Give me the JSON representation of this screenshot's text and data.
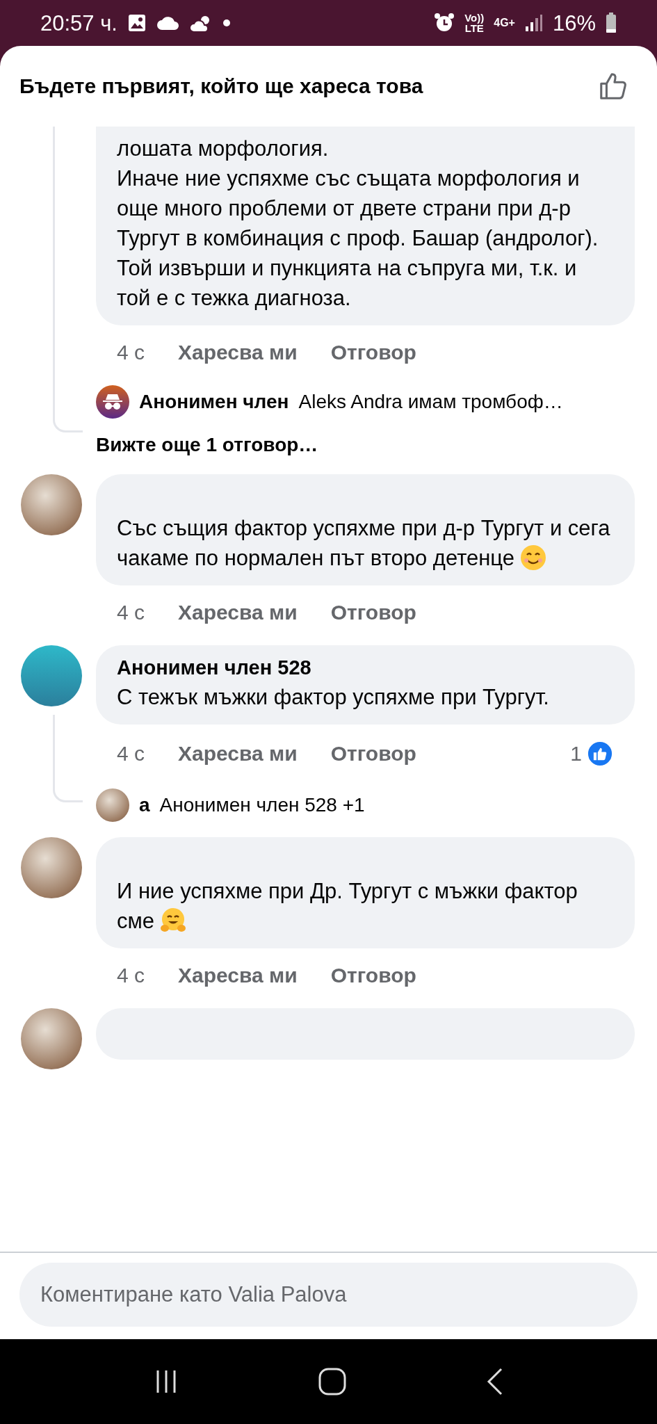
{
  "status_bar": {
    "time": "20:57 ч.",
    "volte": "Vo))",
    "lte": "LTE",
    "network": "4G+",
    "battery": "16%"
  },
  "header": {
    "title": "Бъдете първият, който ще хареса това"
  },
  "comments": [
    {
      "text": "лошата морфология.\nИначе ние успяхме със същата морфология и още много проблеми от двете страни при д-р Тургут в комбинация с проф. Башар (андролог). Той извърши и пункцията на съпруга ми, т.к. и той е с тежка диагноза.",
      "time": "4 с",
      "like": "Харесва ми",
      "reply": "Отговор",
      "reply_preview": {
        "avatar": {
          "kind": "anonymous"
        },
        "name": "Анонимен член",
        "text": "Aleks Andra имам тромбоф…"
      },
      "more_replies": "Вижте още 1 отговор…"
    },
    {
      "avatar": {
        "kind": "photo"
      },
      "text": "Със същия фактор успяхме при д-р Тургут и сега чакаме по нормален път второ детенце",
      "emoji": {
        "kind": "smiling"
      },
      "time": "4 с",
      "like": "Харесва ми",
      "reply": "Отговор"
    },
    {
      "avatar": {
        "kind": "teal"
      },
      "author": "Анонимен член 528",
      "text": "С тежък мъжки фактор успяхме при Тургут.",
      "time": "4 с",
      "like": "Харесва ми",
      "reply": "Отговор",
      "reactions": "1",
      "reply_preview": {
        "avatar": {
          "kind": "photo"
        },
        "name": "а",
        "text": "Анонимен член 528 +1"
      }
    },
    {
      "avatar": {
        "kind": "photo"
      },
      "text": "И ние успяхме при Др. Тургут с мъжки фактор сме",
      "emoji": {
        "kind": "hugging"
      },
      "time": "4 с",
      "like": "Харесва ми",
      "reply": "Отговор"
    },
    {
      "avatar": {
        "kind": "photo"
      }
    }
  ],
  "composer": {
    "placeholder": "Коментиране като Valia Palova"
  }
}
